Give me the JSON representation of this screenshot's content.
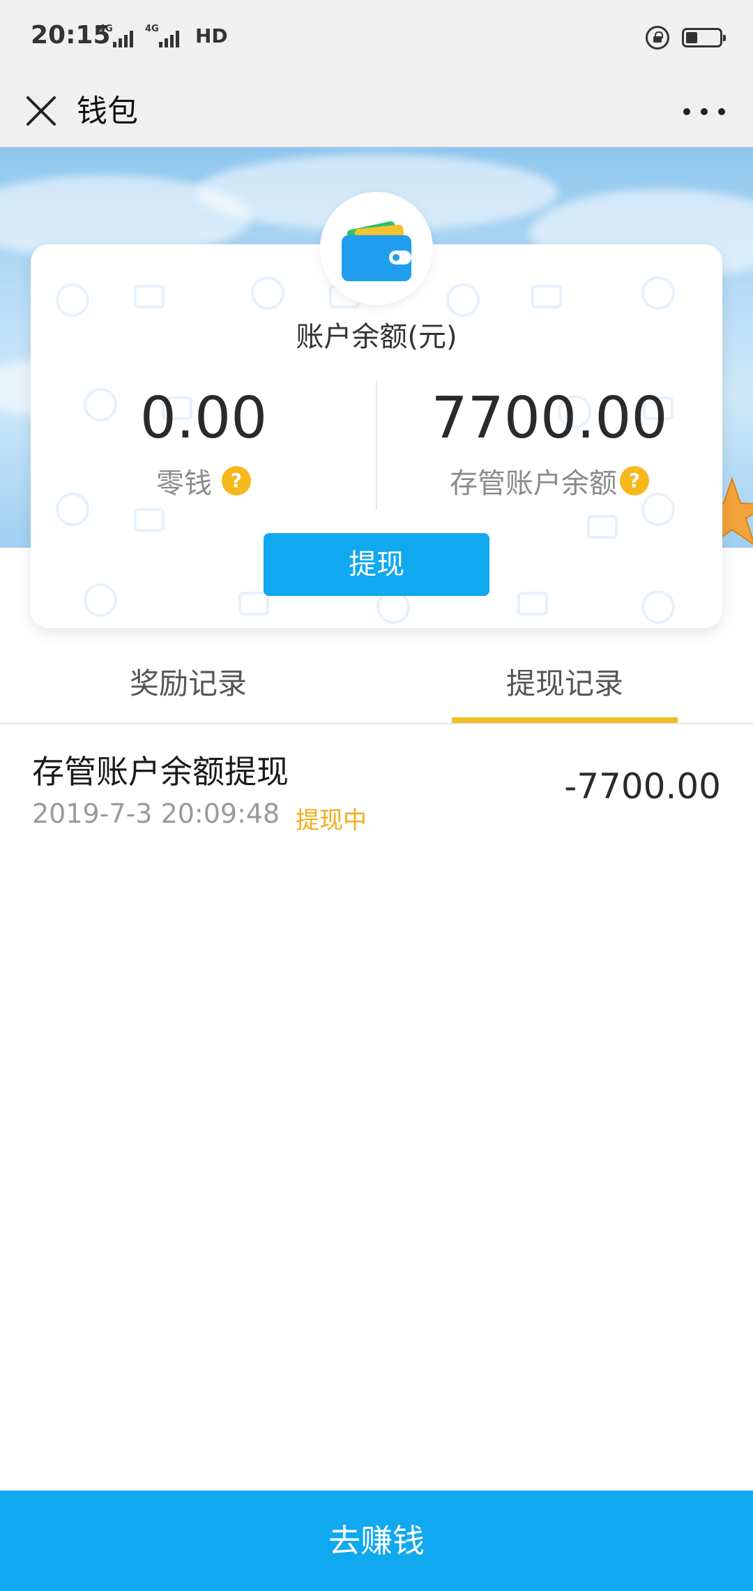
{
  "status_bar": {
    "time": "20:15",
    "signal_1_label": "4G",
    "signal_2_label": "4G",
    "hd_label": "HD",
    "battery_level": 0.35
  },
  "nav": {
    "title": "钱包"
  },
  "card": {
    "title": "账户余额(元)",
    "change_amount": "0.00",
    "change_label": "零钱",
    "custody_amount": "7700.00",
    "custody_label": "存管账户余额",
    "help_glyph": "?",
    "withdraw_label": "提现"
  },
  "tabs": [
    {
      "label": "奖励记录",
      "active": false
    },
    {
      "label": "提现记录",
      "active": true
    }
  ],
  "records": [
    {
      "title": "存管账户余额提现",
      "time": "2019-7-3 20:09:48",
      "status": "提现中",
      "amount": "-7700.00"
    }
  ],
  "bottom_button": {
    "label": "去赚钱"
  },
  "colors": {
    "primary": "#10a8ee",
    "accent_yellow": "#f0be22",
    "status_pending": "#f0ad1e"
  },
  "icons": [
    "close-icon",
    "more-icon",
    "wallet-icon",
    "help-icon",
    "lock-icon",
    "battery-icon",
    "signal-icon",
    "starfish-icon"
  ]
}
